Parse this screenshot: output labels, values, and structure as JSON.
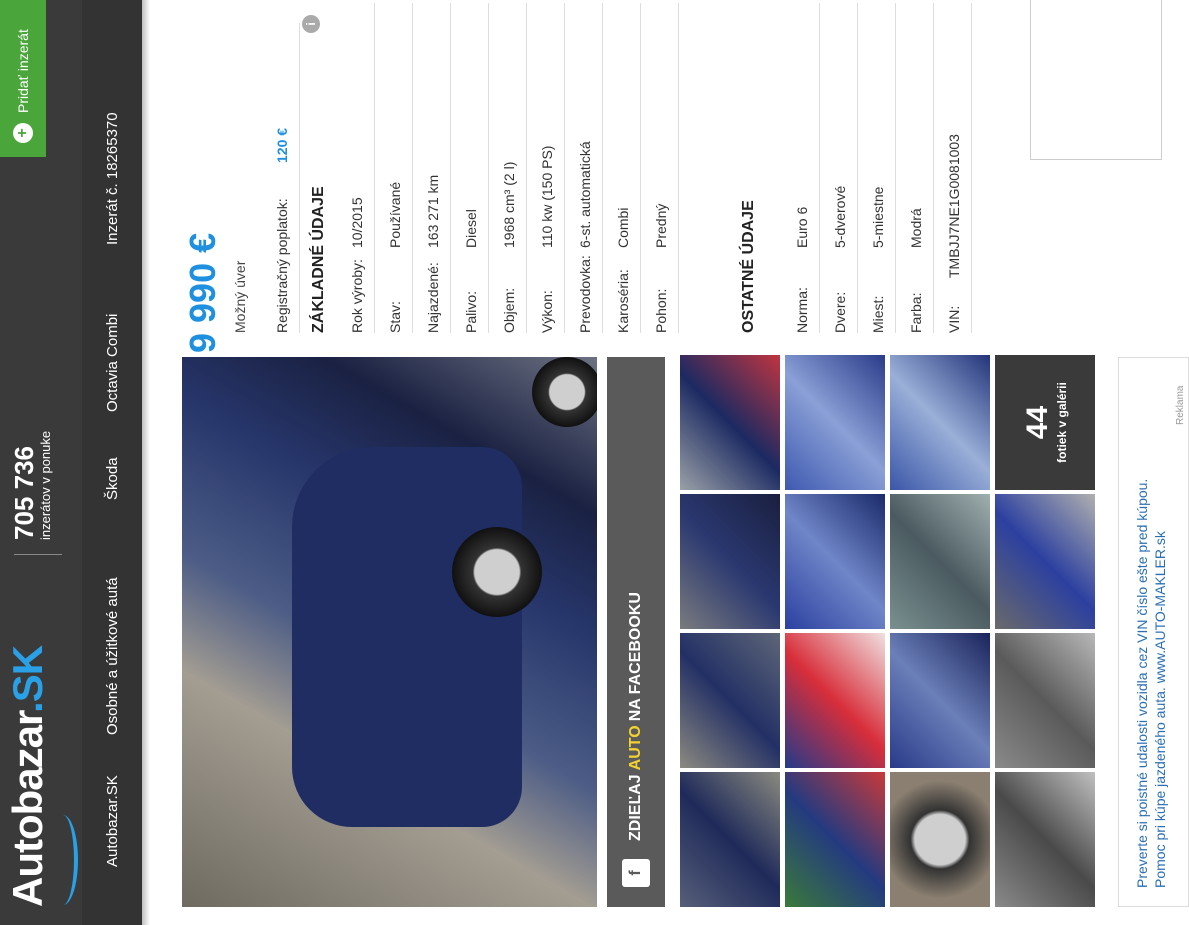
{
  "header": {
    "logo_main": "Autobazar",
    "logo_suffix": ".SK",
    "stats_count": "705 736",
    "stats_label": "inzerátov v ponuke",
    "add_button": "Pridať inzerát"
  },
  "nav": {
    "items": [
      "Autobazar.SK",
      "Osobné a úžitkové autá",
      "Škoda",
      "Octavia Combi",
      "Inzerát č. 18265370"
    ]
  },
  "listing": {
    "price": "9 990 €",
    "loan": "Možný úver",
    "registration_label": "Registračný poplatok:",
    "registration_value": "120 €",
    "basic_title": "ZÁKLADNÉ ÚDAJE",
    "basic": [
      {
        "k": "Rok výroby:",
        "v": "10/2015"
      },
      {
        "k": "Stav:",
        "v": "Používané"
      },
      {
        "k": "Najazdené:",
        "v": "163 271 km"
      },
      {
        "k": "Palivo:",
        "v": "Diesel"
      },
      {
        "k": "Objem:",
        "v": "1968 cm³ (2 l)"
      },
      {
        "k": "Výkon:",
        "v": "110 kw (150 PS)"
      },
      {
        "k": "Prevodovka:",
        "v": "6-st. automatická"
      },
      {
        "k": "Karoséria:",
        "v": "Combi"
      },
      {
        "k": "Pohon:",
        "v": "Predný"
      }
    ],
    "other_title": "OSTATNÉ ÚDAJE",
    "other": [
      {
        "k": "Norma:",
        "v": "Euro 6"
      },
      {
        "k": "Dvere:",
        "v": "5-dverové"
      },
      {
        "k": "Miest:",
        "v": "5-miestne"
      },
      {
        "k": "Farba:",
        "v": "Modrá"
      },
      {
        "k": "VIN:",
        "v": "TMBJJ7NE1G0081003"
      }
    ]
  },
  "gallery": {
    "share_prefix": "ZDIEĽAJ ",
    "share_highlight": "AUTO",
    "share_suffix": " NA FACEBOOKU",
    "more_count": "44",
    "more_label": "fotiek v galérii"
  },
  "ad": {
    "line1": "Preverte si poistné udalosti vozidla cez VIN číslo ešte pred kúpou.",
    "line2": "Pomoc pri kúpe jazdeného auta. www.AUTO-MAKLER.sk",
    "note": "Reklama"
  }
}
